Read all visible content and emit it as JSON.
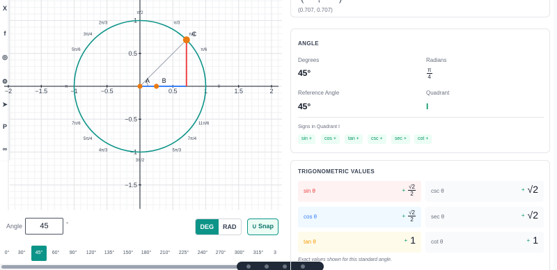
{
  "share_rail": {
    "icons": [
      "x-icon",
      "facebook-icon",
      "whatsapp-icon",
      "reddit-icon",
      "telegram-icon",
      "pinterest-icon",
      "link-icon"
    ],
    "glyphs": [
      "X",
      "f",
      "◎",
      "⚙",
      "➤",
      "P",
      "∞"
    ]
  },
  "plot": {
    "x_ticks": [
      "−2",
      "−1.5",
      "−1",
      "−0.5",
      "0.5",
      "1",
      "1.5",
      "2"
    ],
    "y_ticks": [
      "1",
      "0.5",
      "−0.5",
      "−1",
      "−1.5"
    ],
    "angle_labels": [
      "π/2",
      "π/3",
      "2π/3",
      "π/4",
      "3π/4",
      "π/6",
      "5π/6",
      "π",
      "0",
      "7π/6",
      "11π/6",
      "5π/4",
      "7π/4",
      "4π/3",
      "5π/3",
      "3π/2"
    ],
    "point_labels": [
      "A",
      "B",
      "C"
    ],
    "colors": {
      "circle": "#0d9488",
      "sine": "#ef4444",
      "cosine": "#3b82f6",
      "point": "#ea7a12",
      "hypotenuse": "#9ca3af"
    }
  },
  "chart_data": {
    "type": "scatter",
    "title": "",
    "xlabel": "",
    "ylabel": "",
    "xlim": [
      -2,
      2
    ],
    "ylim": [
      -1.8,
      1.1
    ],
    "x_ticks": [
      -2,
      -1.5,
      -1,
      -0.5,
      0.5,
      1,
      1.5,
      2
    ],
    "y_ticks": [
      1,
      0.5,
      -0.5,
      -1,
      -1.5
    ],
    "grid": true,
    "unit_circle_radius": 1,
    "angle_deg": 45,
    "points": [
      {
        "label": "A",
        "x": 0,
        "y": 0
      },
      {
        "label": "B",
        "x": 0.25,
        "y": 0
      },
      {
        "label": "C",
        "x": 0.707,
        "y": 0.707
      }
    ],
    "special_angles_deg": [
      90,
      60,
      120,
      45,
      135,
      30,
      150,
      180,
      0,
      210,
      330,
      225,
      315,
      240,
      300,
      270
    ]
  },
  "controls": {
    "angle_label": "Angle",
    "angle_value": "45",
    "degree_symbol": "°",
    "unit_options": [
      "DEG",
      "RAD"
    ],
    "active_unit": "DEG",
    "snap_label": "Snap",
    "snap_icon": "magnet-icon",
    "presets": [
      "0°",
      "30°",
      "45°",
      "60°",
      "90°",
      "120°",
      "135°",
      "150°",
      "180°",
      "210°",
      "225°",
      "240°",
      "270°",
      "300°",
      "315°",
      "3"
    ],
    "active_preset": "45°"
  },
  "coordinates": {
    "text": "(0.707, 0.707)"
  },
  "angle_card": {
    "title": "ANGLE",
    "degrees_label": "Degrees",
    "degrees_value": "45°",
    "radians_label": "Radians",
    "radians_num": "π",
    "radians_den": "4",
    "reference_label": "Reference Angle",
    "reference_value": "45°",
    "quadrant_label": "Quadrant",
    "quadrant_value": "I",
    "signs_label": "Signs in Quadrant I",
    "signs": [
      "sin +",
      "cos +",
      "tan +",
      "csc +",
      "sec +",
      "cot +"
    ]
  },
  "trig_card": {
    "title": "TRIGONOMETRIC VALUES",
    "rows": [
      {
        "name": "sin θ",
        "sign": "+",
        "num": "√2",
        "den": "2",
        "color": "#ef4444",
        "bg": "#fef2f2"
      },
      {
        "name": "csc θ",
        "sign": "+",
        "value": "√2",
        "color": "#6b7280",
        "bg": "#f9fafb"
      },
      {
        "name": "cos θ",
        "sign": "+",
        "num": "√2",
        "den": "2",
        "color": "#3b82f6",
        "bg": "#f0f9ff"
      },
      {
        "name": "sec θ",
        "sign": "+",
        "value": "√2",
        "color": "#6b7280",
        "bg": "#f9fafb"
      },
      {
        "name": "tan θ",
        "sign": "+",
        "value": "1",
        "color": "#f59e0b",
        "bg": "#fffbeb"
      },
      {
        "name": "cot θ",
        "sign": "+",
        "value": "1",
        "color": "#6b7280",
        "bg": "#f9fafb"
      }
    ],
    "footnote": "Exact values shown for this standard angle."
  }
}
